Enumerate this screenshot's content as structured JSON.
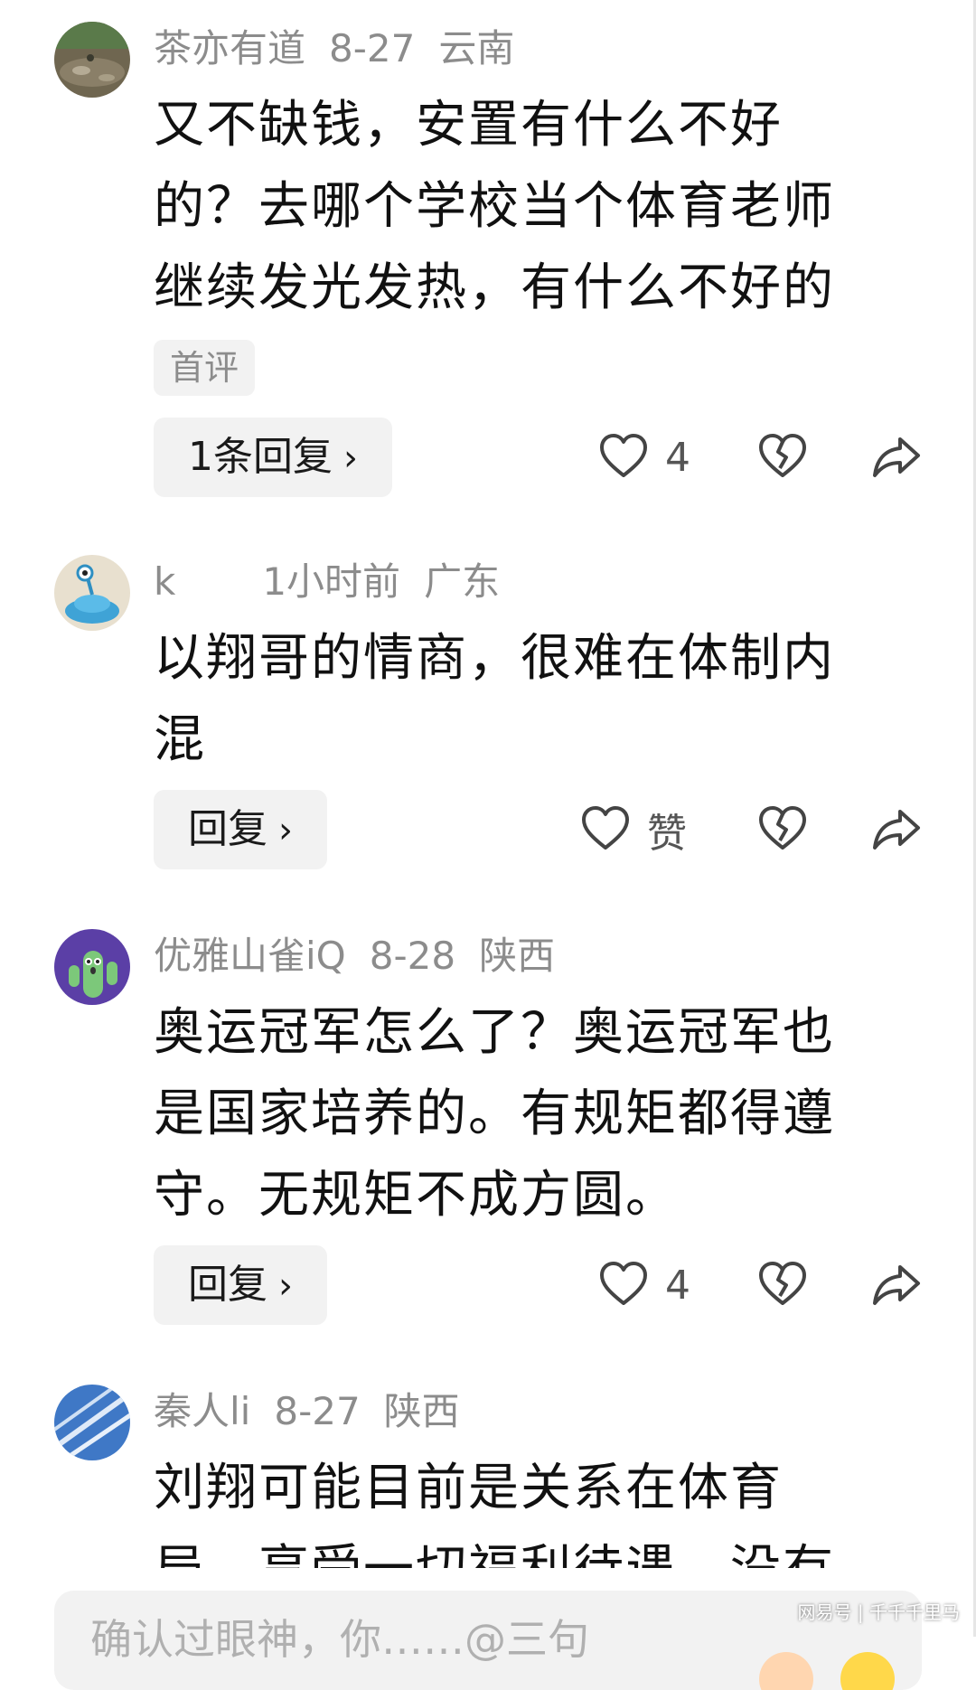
{
  "comments": [
    {
      "user": "茶亦有道",
      "date": "8-27",
      "location": "云南",
      "lines": [
        "又不缺钱，安置有什么不好",
        "的？去哪个学校当个体育老师",
        "继续发光发热，有什么不好的"
      ],
      "tag": "首评",
      "reply_label": "1条回复",
      "like_count": "4"
    },
    {
      "user": "k",
      "date": "1小时前",
      "location": "广东",
      "lines": [
        "以翔哥的情商，很难在体制内",
        "混"
      ],
      "reply_label": "回复",
      "like_count": "赞"
    },
    {
      "user": "优雅山雀iQ",
      "date": "8-28",
      "location": "陕西",
      "lines": [
        "奥运冠军怎么了？奥运冠军也",
        "是国家培养的。有规矩都得遵",
        "守。无规矩不成方圆。"
      ],
      "reply_label": "回复",
      "like_count": "4"
    },
    {
      "user": "秦人li",
      "date": "8-27",
      "location": "陕西",
      "lines": [
        "刘翔可能目前是关系在体育",
        "局，享受一切福利待遇，没有"
      ]
    }
  ],
  "input": {
    "placeholder": "确认过眼神，你……@三句"
  },
  "watermark": "网易号 | 千千千里马",
  "icons": {
    "like": "heart-outline-icon",
    "dislike": "broken-heart-icon",
    "share": "share-arrow-icon",
    "chevron": "chevron-right-icon"
  }
}
